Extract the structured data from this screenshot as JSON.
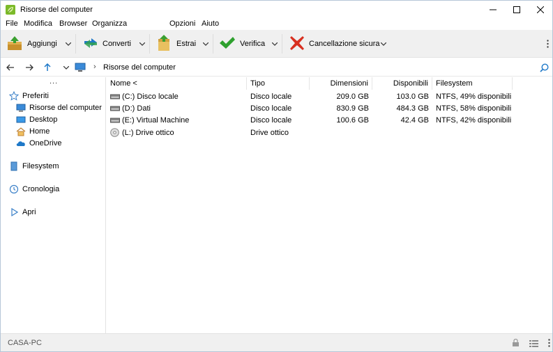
{
  "window": {
    "title": "Risorse del computer",
    "app_icon": "peazip-leaf-icon"
  },
  "menu": {
    "items": [
      "File",
      "Modifica",
      "Browser",
      "Organizza",
      "Opzioni",
      "Aiuto"
    ]
  },
  "toolbar": {
    "buttons": [
      {
        "label": "Aggiungi",
        "icon": "add-archive-icon"
      },
      {
        "label": "Converti",
        "icon": "convert-arrows-icon"
      },
      {
        "label": "Estrai",
        "icon": "extract-folder-icon"
      },
      {
        "label": "Verifica",
        "icon": "check-icon"
      },
      {
        "label": "Cancellazione sicura",
        "icon": "secure-delete-x-icon"
      }
    ]
  },
  "address": {
    "current": "Risorse del computer"
  },
  "sidebar": {
    "dots": "...",
    "items": [
      {
        "label": "Preferiti",
        "icon": "star-icon"
      },
      {
        "label": "Risorse del computer",
        "icon": "computer-icon"
      },
      {
        "label": "Desktop",
        "icon": "desktop-icon"
      },
      {
        "label": "Home",
        "icon": "home-icon"
      },
      {
        "label": "OneDrive",
        "icon": "cloud-icon"
      },
      {
        "label": "Filesystem",
        "icon": "filesystem-icon"
      },
      {
        "label": "Cronologia",
        "icon": "clock-icon"
      },
      {
        "label": "Apri",
        "icon": "play-icon"
      }
    ]
  },
  "table": {
    "columns": [
      "Nome <",
      "Tipo",
      "Dimensioni",
      "Disponibili",
      "Filesystem"
    ],
    "rows": [
      {
        "name": "(C:) Disco locale",
        "type": "Disco locale",
        "size": "209.0 GB",
        "free": "103.0 GB",
        "fs": "NTFS, 49% disponibili",
        "icon": "hard-drive-icon"
      },
      {
        "name": "(D:) Dati",
        "type": "Disco locale",
        "size": "830.9 GB",
        "free": "484.3 GB",
        "fs": "NTFS, 58% disponibili",
        "icon": "hard-drive-icon"
      },
      {
        "name": "(E:) Virtual Machine",
        "type": "Disco locale",
        "size": "100.6 GB",
        "free": "42.4 GB",
        "fs": "NTFS, 42% disponibili",
        "icon": "hard-drive-icon"
      },
      {
        "name": "(L:) Drive ottico",
        "type": "Drive ottico",
        "size": "",
        "free": "",
        "fs": "",
        "icon": "optical-disc-icon"
      }
    ]
  },
  "status": {
    "text": "CASA-PC"
  },
  "colors": {
    "toolbar_bg": "#f0f0f0",
    "accent_blue": "#1e78c8",
    "check_green": "#2ea02e",
    "delete_red": "#d83020"
  }
}
